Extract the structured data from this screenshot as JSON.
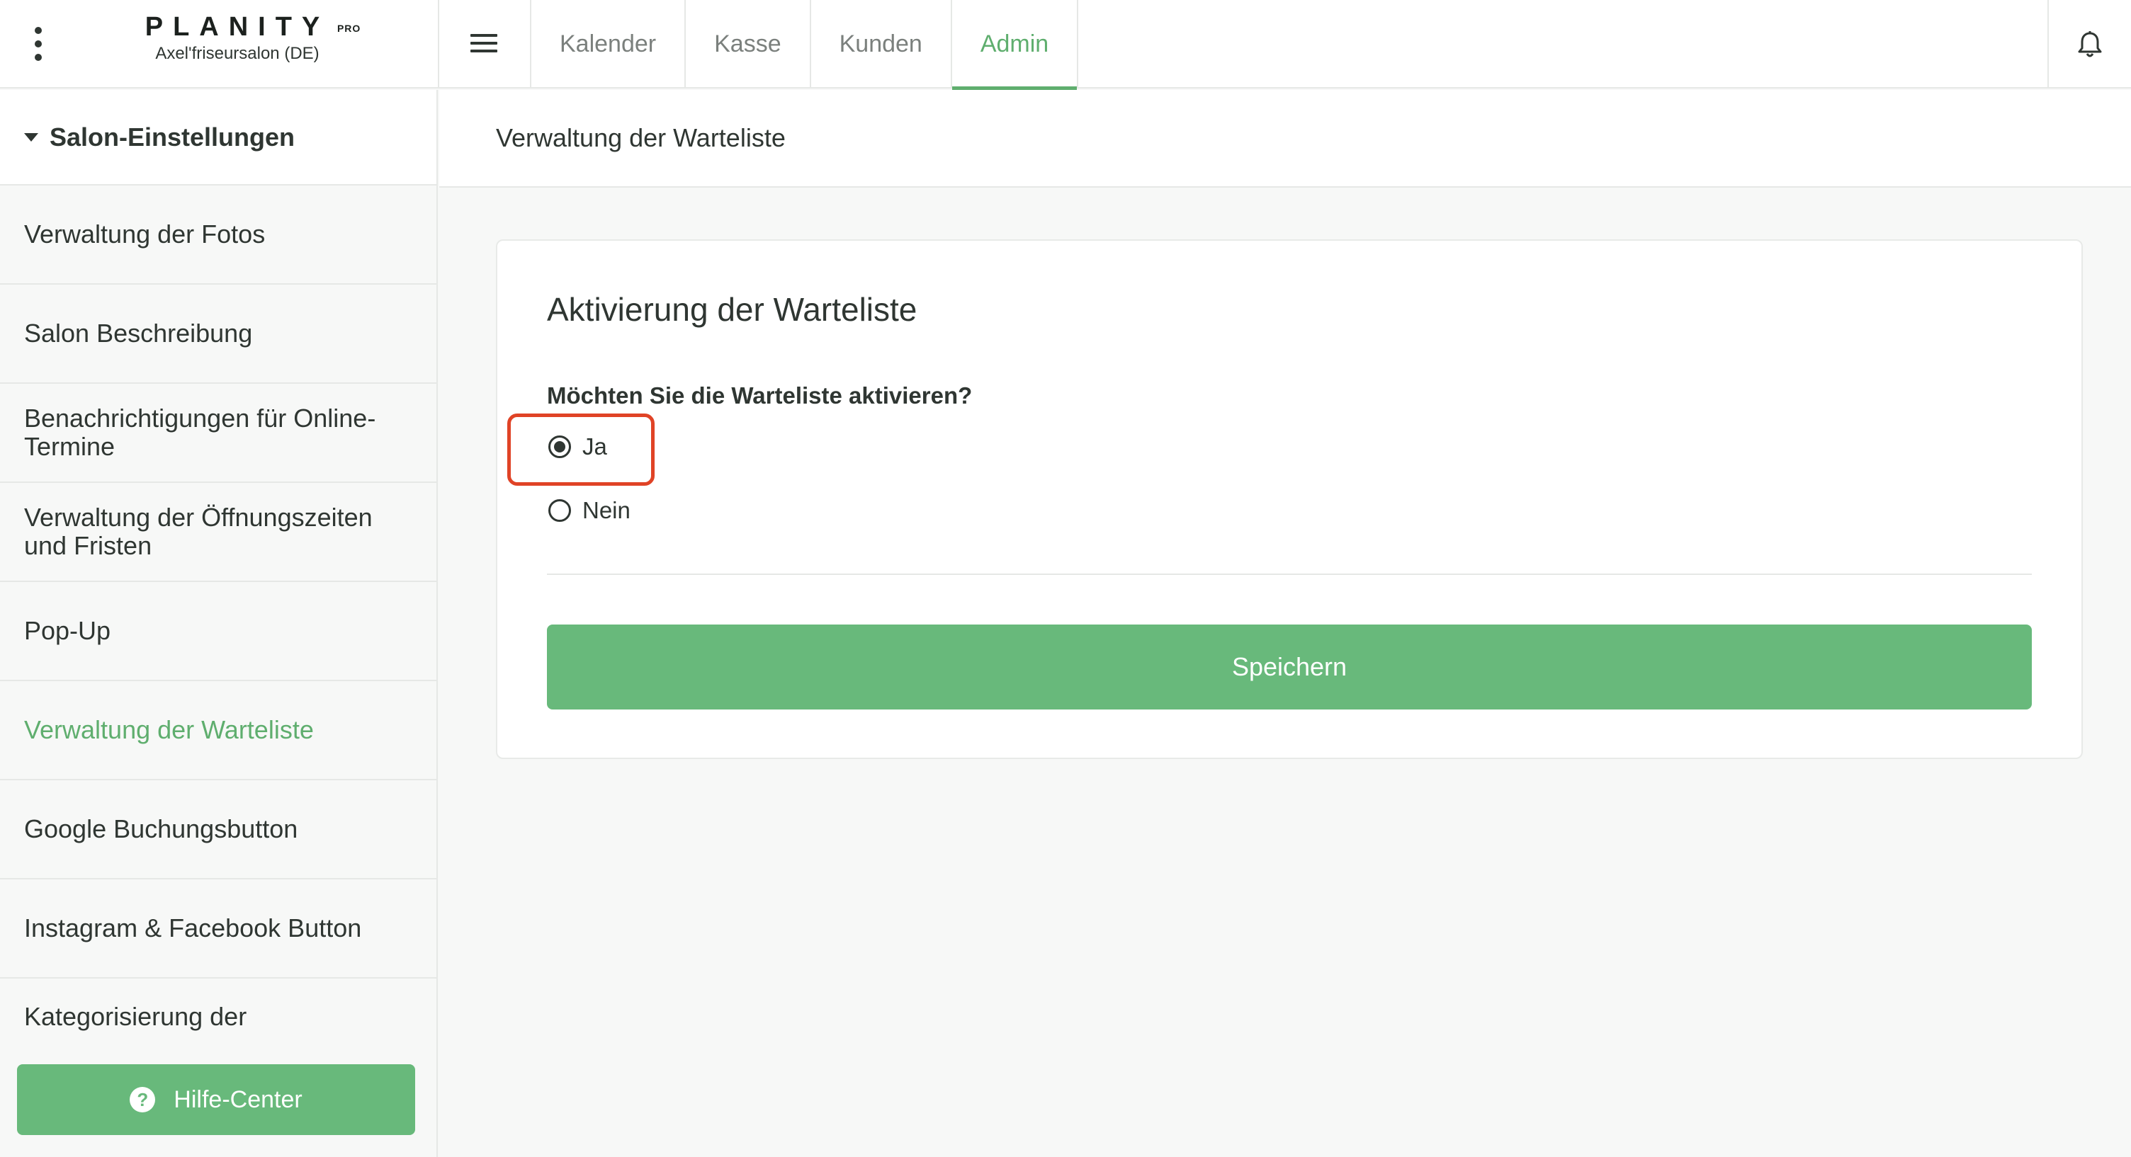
{
  "app": {
    "brand": "PLANITY",
    "brand_badge": "PRO",
    "salon_name": "Axel'friseursalon (DE)"
  },
  "nav": {
    "tabs": [
      {
        "label": "Kalender",
        "active": false
      },
      {
        "label": "Kasse",
        "active": false
      },
      {
        "label": "Kunden",
        "active": false
      },
      {
        "label": "Admin",
        "active": true
      }
    ]
  },
  "icons": {
    "kebab": "more-vertical-icon",
    "menu": "hamburger-menu-icon",
    "bell": "bell-icon",
    "caret": "caret-down-icon",
    "help": "help-circle-icon"
  },
  "sidebar": {
    "section_title": "Salon-Einstellungen",
    "items": [
      {
        "label": "Verwaltung der Fotos",
        "active": false
      },
      {
        "label": "Salon Beschreibung",
        "active": false
      },
      {
        "label": "Benachrichtigungen für Online-Termine",
        "active": false
      },
      {
        "label": "Verwaltung der Öffnungszeiten und Fristen",
        "active": false
      },
      {
        "label": "Pop-Up",
        "active": false
      },
      {
        "label": "Verwaltung der Warteliste",
        "active": true
      },
      {
        "label": "Google Buchungsbutton",
        "active": false
      },
      {
        "label": "Instagram & Facebook Button",
        "active": false
      },
      {
        "label": "Kategorisierung der Dienstleistungen",
        "active": false
      }
    ],
    "help_button": "Hilfe-Center"
  },
  "main": {
    "page_title": "Verwaltung der Warteliste",
    "card_title": "Aktivierung der Warteliste",
    "question": "Möchten Sie die Warteliste aktivieren?",
    "options": [
      {
        "label": "Ja",
        "selected": true
      },
      {
        "label": "Nein",
        "selected": false
      }
    ],
    "save_button": "Speichern"
  },
  "colors": {
    "accent": "#5fae6e",
    "button": "#68b97b",
    "highlight": "#e04326"
  }
}
